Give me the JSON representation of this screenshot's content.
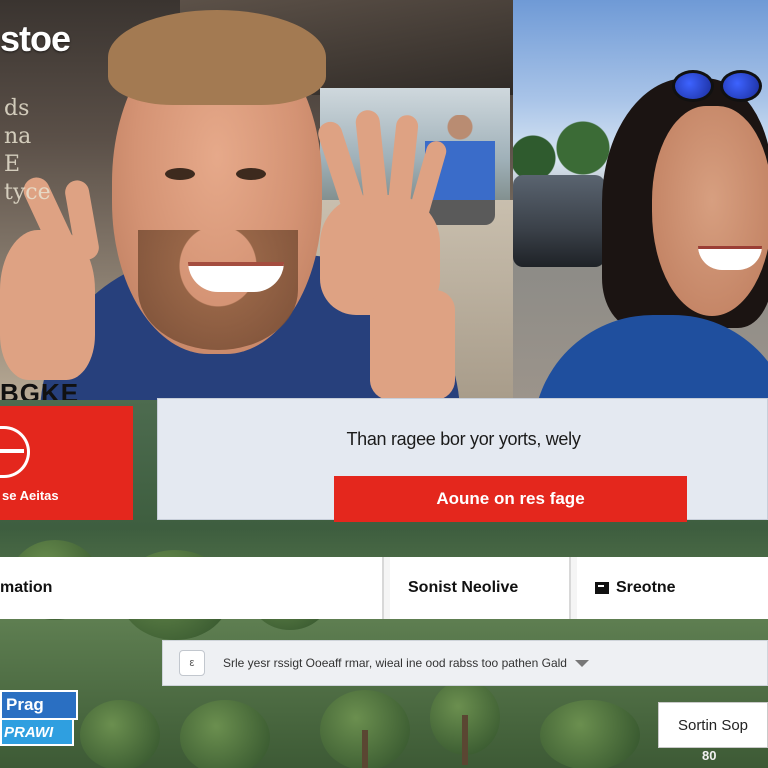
{
  "hero": {
    "brand_logo": "stoe",
    "sign_text": "ds na E tyce",
    "tattoo_text": "BGKE"
  },
  "brand_card": {
    "label": "se Aeitas",
    "logo_icon": "swoosh-circle-icon"
  },
  "promo": {
    "headline": "Than ragee bor yor yorts, wely",
    "cta_label": "Aoune on res fage"
  },
  "nav": {
    "items": [
      {
        "label": "mation"
      },
      {
        "label": "Sonist Neolive"
      },
      {
        "label": "Sreotne",
        "icon": "document-icon"
      }
    ]
  },
  "notice": {
    "icon_label": "ε",
    "text": "Srle yesr rssigt Ooeaff rmar, wieal ine ood rabss too pathen Gald",
    "caret_icon": "caret-down-icon"
  },
  "badge": {
    "top": "Prag",
    "bottom": "PRAWI"
  },
  "shop_button": "Sortin Sop",
  "page_number": "80",
  "colors": {
    "accent_red": "#e4271d",
    "panel_bg": "#e4e9f1",
    "badge_blue": "#2a6fc2"
  }
}
